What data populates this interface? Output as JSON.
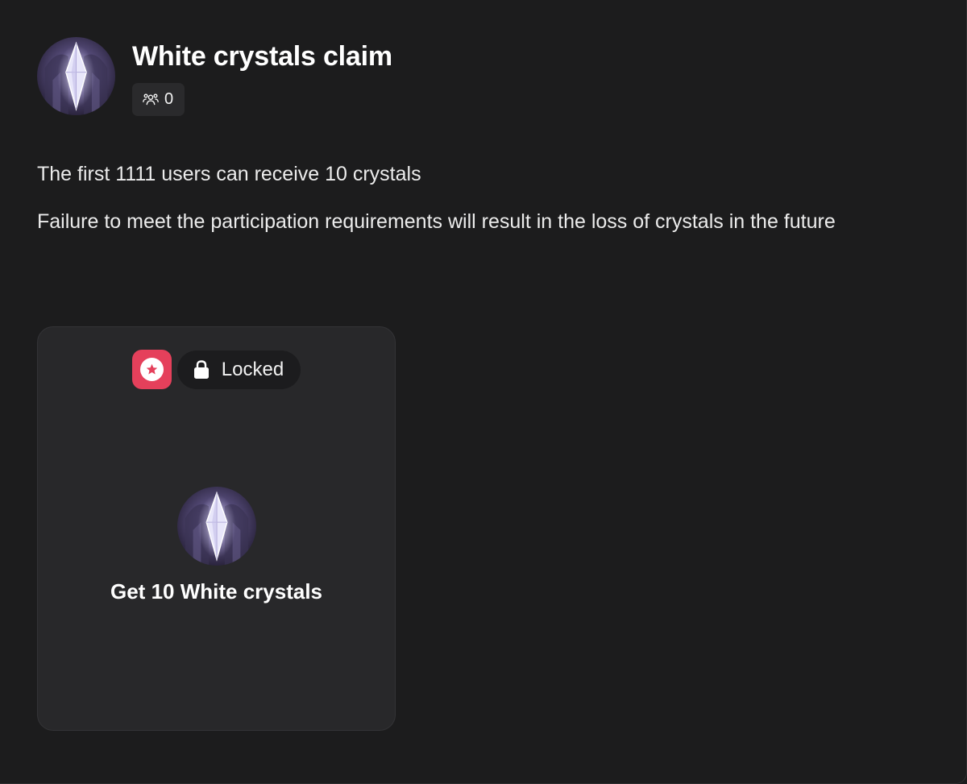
{
  "header": {
    "title": "White crystals claim",
    "avatar_icon": "white-crystal-icon",
    "members_icon": "users-icon",
    "members_count": "0"
  },
  "description": {
    "line1": "The first 1111 users can receive 10 crystals",
    "line2": "Failure to meet the participation requirements will result in the loss of crystals in the future"
  },
  "card": {
    "star_icon": "star-icon",
    "lock_icon": "lock-icon",
    "lock_label": "Locked",
    "reward_icon": "white-crystal-icon",
    "reward_title": "Get 10 White crystals"
  },
  "colors": {
    "background": "#1c1c1d",
    "card_background": "#28282a",
    "badge_background": "#2a2a2c",
    "star_badge": "#e5405b",
    "text": "#ffffff"
  }
}
